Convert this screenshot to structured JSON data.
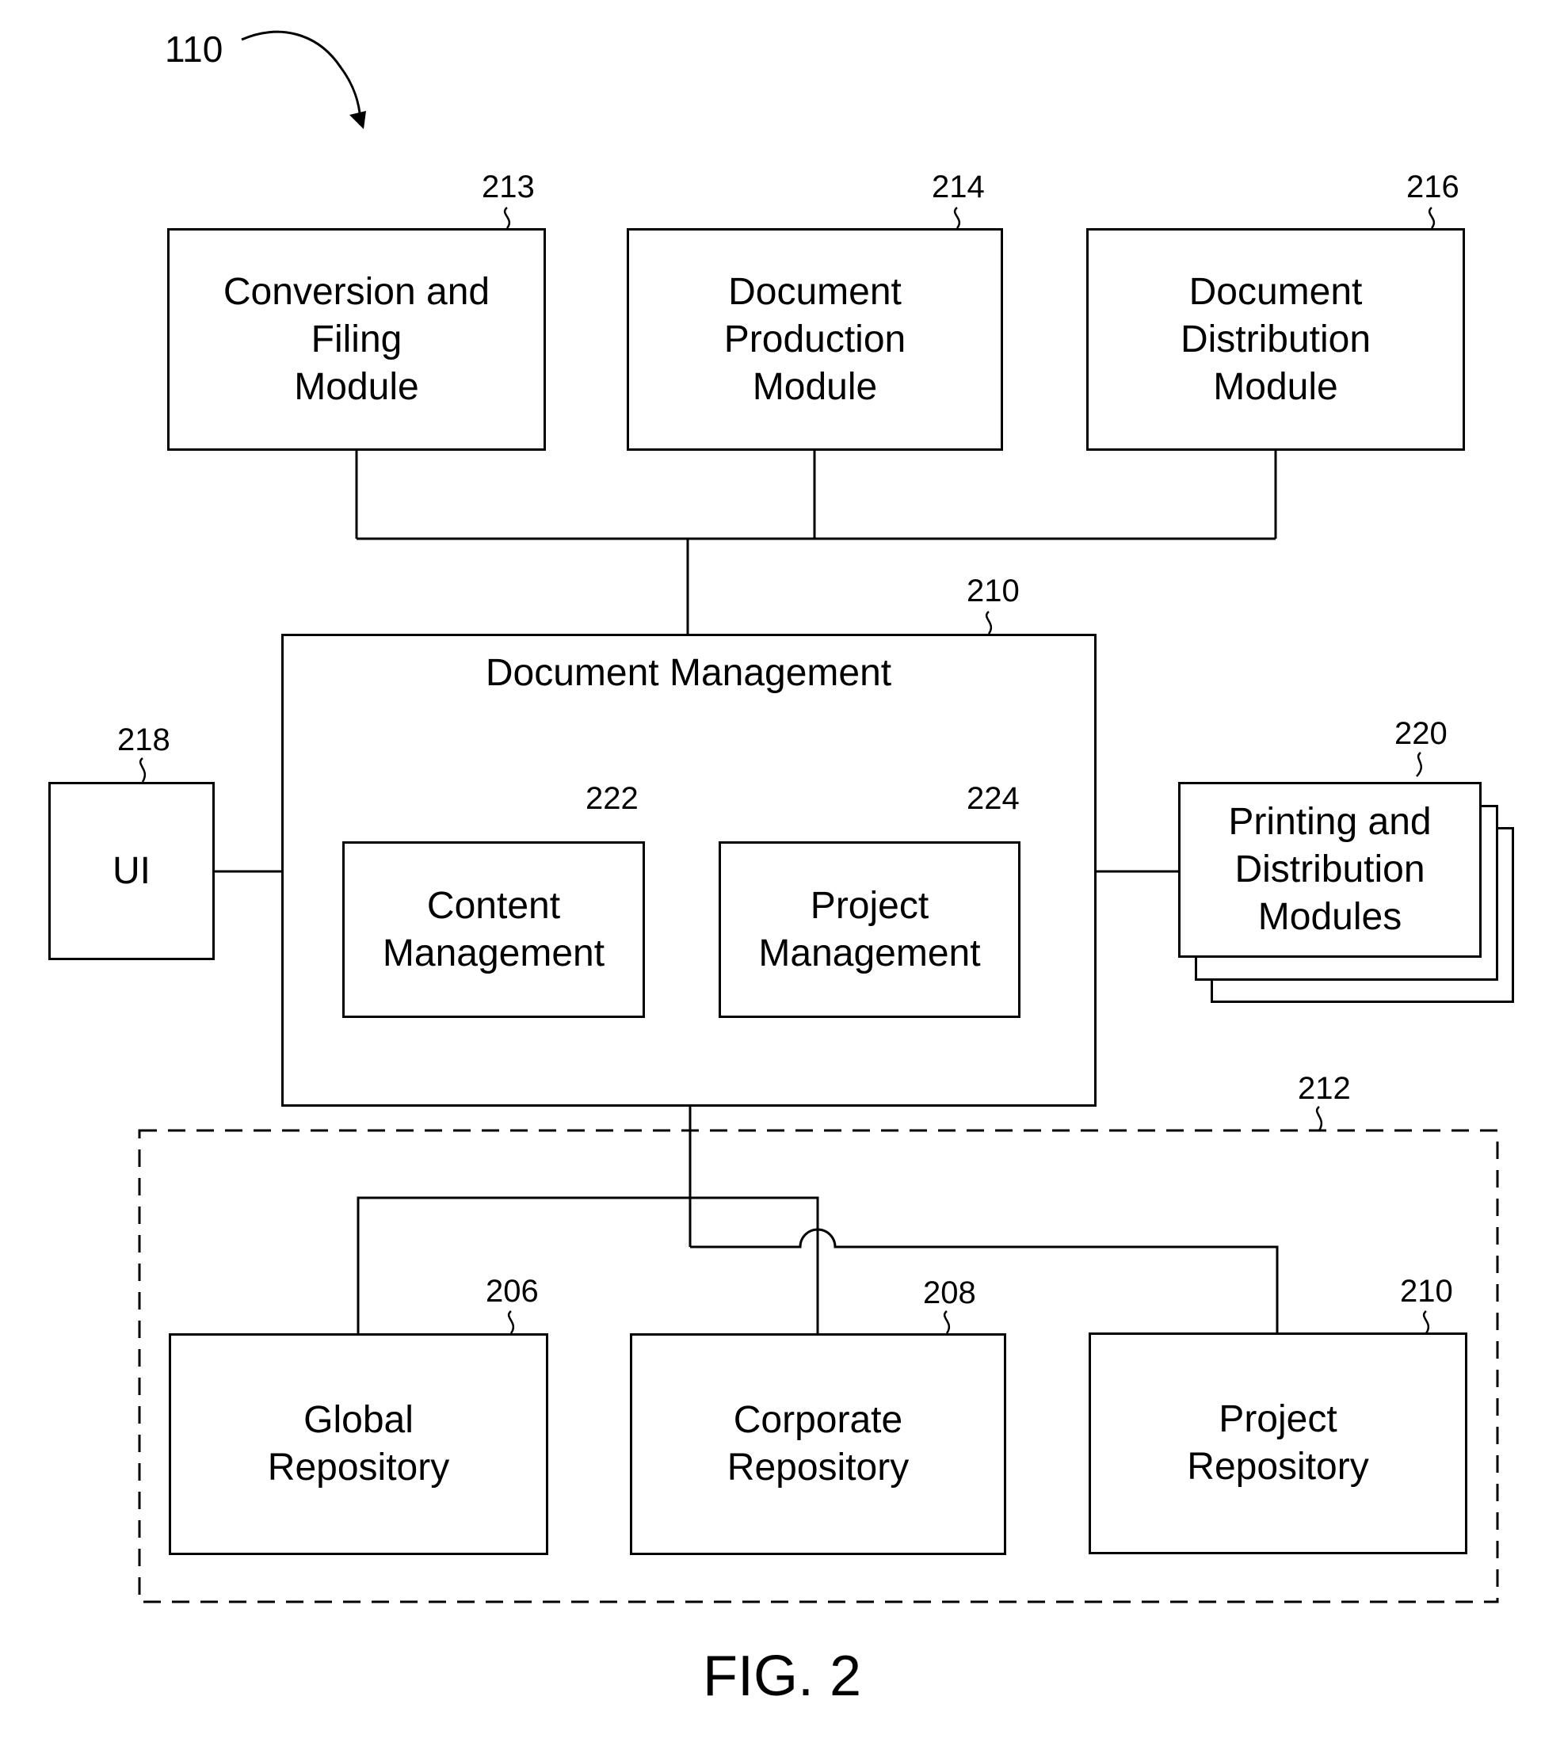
{
  "figure": {
    "ref_main": "110",
    "caption": "FIG. 2"
  },
  "top_modules": [
    {
      "ref": "213",
      "label": "Conversion and\nFiling\nModule"
    },
    {
      "ref": "214",
      "label": "Document\nProduction\nModule"
    },
    {
      "ref": "216",
      "label": "Document\nDistribution\nModule"
    }
  ],
  "document_management": {
    "ref": "210",
    "title": "Document Management",
    "children": [
      {
        "ref": "222",
        "label": "Content\nManagement"
      },
      {
        "ref": "224",
        "label": "Project\nManagement"
      }
    ]
  },
  "ui": {
    "ref": "218",
    "label": "UI"
  },
  "printing": {
    "ref": "220",
    "label": "Printing and\nDistribution\nModules"
  },
  "repositories": {
    "ref": "212",
    "items": [
      {
        "ref": "206",
        "label": "Global\nRepository"
      },
      {
        "ref": "208",
        "label": "Corporate\nRepository"
      },
      {
        "ref": "210",
        "label": "Project\nRepository"
      }
    ]
  }
}
